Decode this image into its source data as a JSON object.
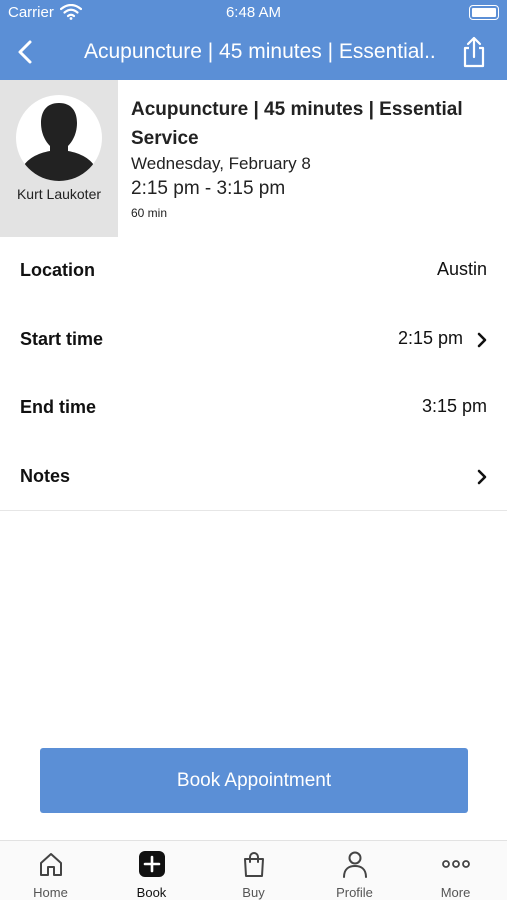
{
  "status_bar": {
    "carrier": "Carrier",
    "time": "6:48 AM"
  },
  "nav": {
    "title": "Acupuncture | 45 minutes | Essential Service"
  },
  "appointment": {
    "provider_name": "Kurt Laukoter",
    "service_title": "Acupuncture | 45 minutes | Essential Service",
    "date": "Wednesday, February 8",
    "time_range": "2:15 pm - 3:15 pm",
    "duration": "60 min"
  },
  "details": {
    "location": {
      "label": "Location",
      "value": "Austin"
    },
    "start_time": {
      "label": "Start time",
      "value": "2:15 pm"
    },
    "end_time": {
      "label": "End time",
      "value": "3:15 pm"
    },
    "notes": {
      "label": "Notes"
    }
  },
  "book_button": {
    "label": "Book Appointment"
  },
  "tabs": [
    {
      "label": "Home",
      "icon": "home-icon"
    },
    {
      "label": "Book",
      "icon": "plus-square-icon"
    },
    {
      "label": "Buy",
      "icon": "shopping-bag-icon"
    },
    {
      "label": "Profile",
      "icon": "person-icon"
    },
    {
      "label": "More",
      "icon": "more-icon"
    }
  ],
  "colors": {
    "accent": "#5b8fd6",
    "avatar_bg": "#e3e3e3"
  }
}
